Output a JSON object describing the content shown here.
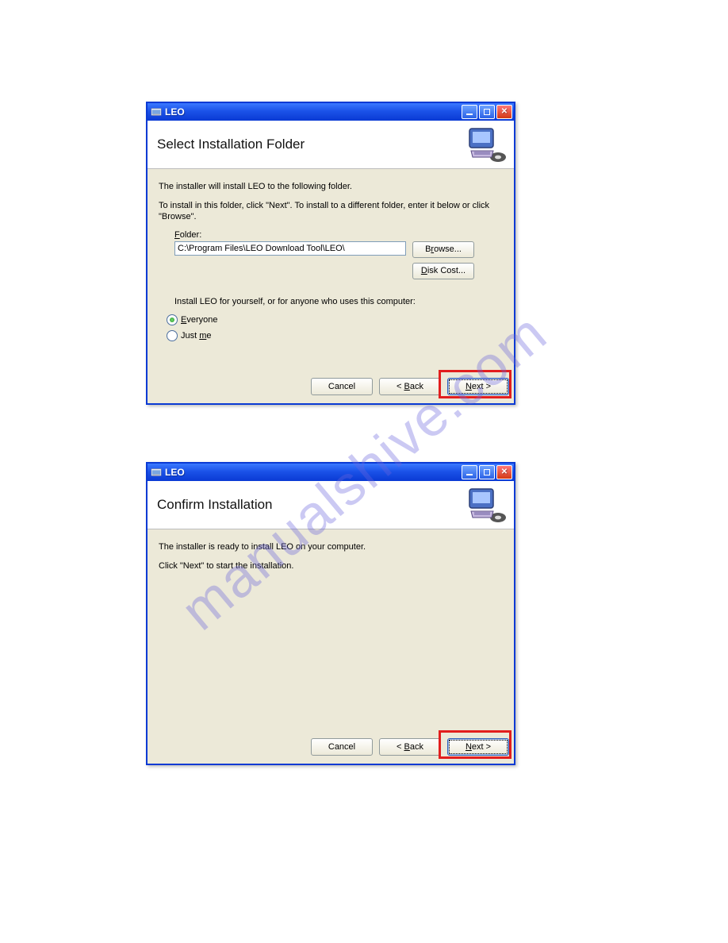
{
  "watermark_text": "manualshive.com",
  "dialog1": {
    "title": "LEO",
    "banner_title": "Select Installation Folder",
    "line1": "The installer will install LEO to the following folder.",
    "line2": "To install in this folder, click \"Next\". To install to a different folder, enter it below or click \"Browse\".",
    "folder_label": "Folder:",
    "folder_value": "C:\\Program Files\\LEO Download Tool\\LEO\\",
    "browse_label": "Browse...",
    "disk_cost_label": "Disk Cost...",
    "install_for_label": "Install LEO for yourself, or for anyone who uses this computer:",
    "radio_everyone": "Everyone",
    "radio_justme": "Just me",
    "cancel_label": "Cancel",
    "back_label": "< Back",
    "next_label": "Next >"
  },
  "dialog2": {
    "title": "LEO",
    "banner_title": "Confirm Installation",
    "line1": "The installer is ready to install LEO on your computer.",
    "line2": "Click \"Next\" to start the installation.",
    "cancel_label": "Cancel",
    "back_label": "< Back",
    "next_label": "Next >"
  }
}
